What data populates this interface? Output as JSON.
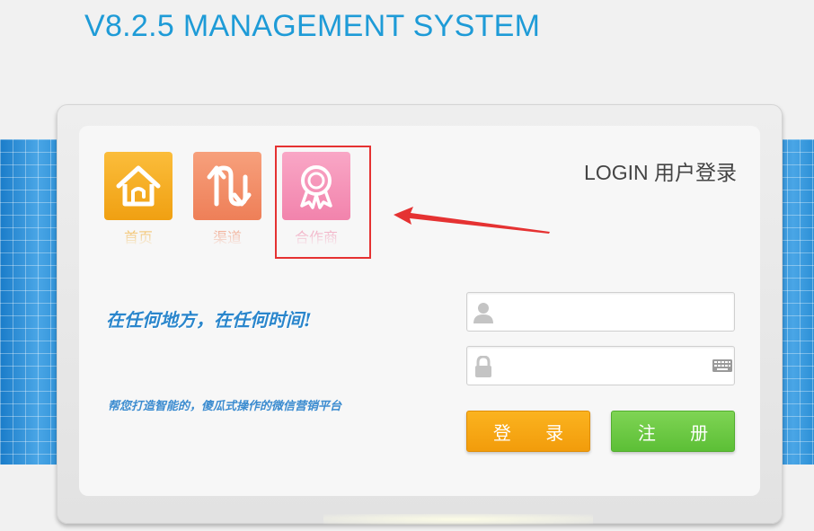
{
  "header": {
    "title": "V8.2.5 MANAGEMENT SYSTEM"
  },
  "tiles": [
    {
      "label": "首页",
      "icon": "home-icon"
    },
    {
      "label": "渠道",
      "icon": "transfer-arrows-icon"
    },
    {
      "label": "合作商",
      "icon": "award-ribbon-icon"
    }
  ],
  "login": {
    "title": "LOGIN 用户登录",
    "username": {
      "value": "",
      "placeholder": ""
    },
    "password": {
      "value": "",
      "placeholder": ""
    },
    "login_label": "登 录",
    "register_label": "注 册"
  },
  "slogan": {
    "main": "在任何地方，在任何时间!",
    "sub": "帮您打造智能的，傻瓜式操作的微信营销平台"
  },
  "colors": {
    "title": "#1e9bd7",
    "home_tile": "#f0a012",
    "channel_tile": "#ee7f58",
    "partner_tile": "#f283ac",
    "login_button": "#f29c0b",
    "register_button": "#5cbf36",
    "highlight": "#e53232"
  }
}
